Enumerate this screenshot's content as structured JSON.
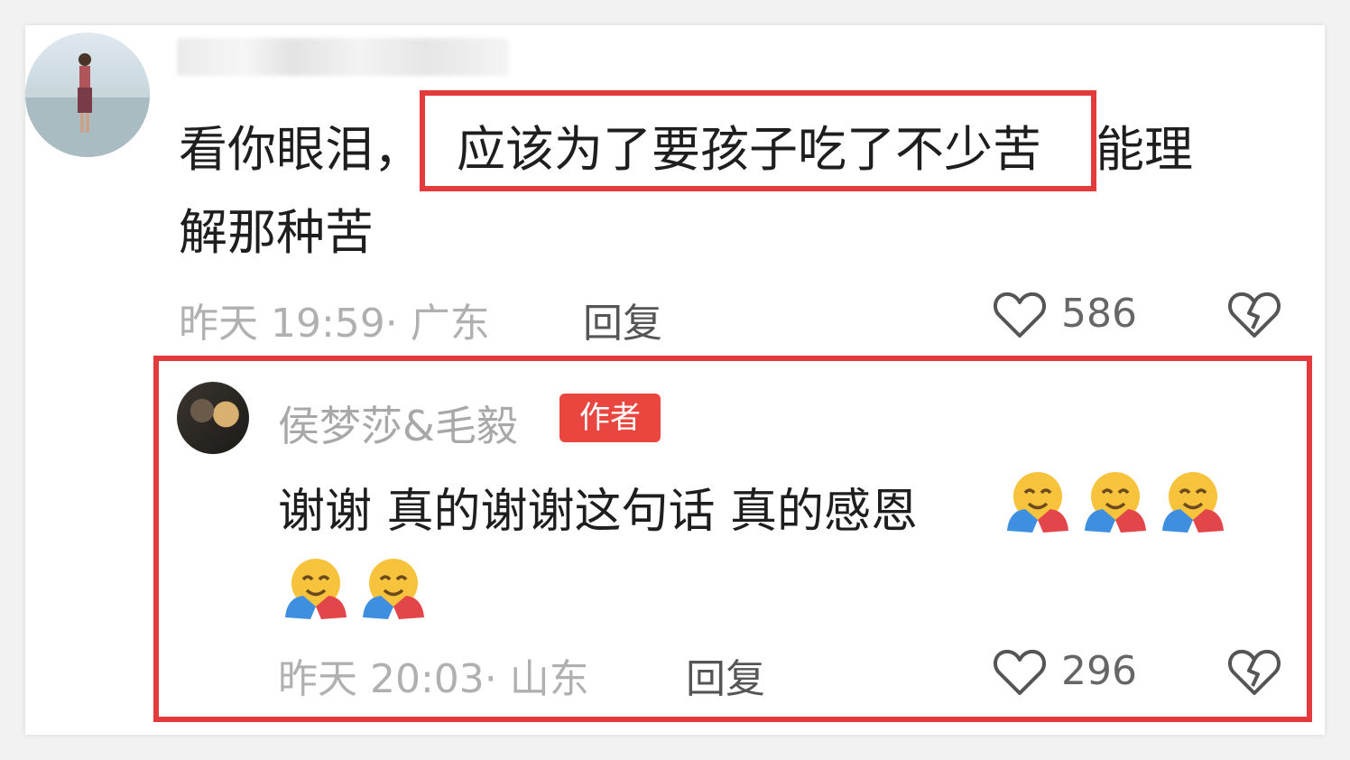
{
  "comment": {
    "text_before": "看你眼泪，",
    "highlighted": "应该为了要孩子吃了不少苦",
    "text_after": "能理",
    "text_line2": "解那种苦",
    "time": "昨天 19:59",
    "location": "· 广东",
    "reply_label": "回复",
    "likes": "586"
  },
  "reply": {
    "author": "侯梦莎&毛毅",
    "badge": "作者",
    "text": "谢谢 真的谢谢这句话 真的感恩",
    "emoji_name": "hugging-face-emoji",
    "time": "昨天 20:03",
    "location": "· 山东",
    "reply_label": "回复",
    "likes": "296"
  },
  "colors": {
    "highlight_border": "#e33b3b",
    "author_badge": "#e8463f"
  }
}
